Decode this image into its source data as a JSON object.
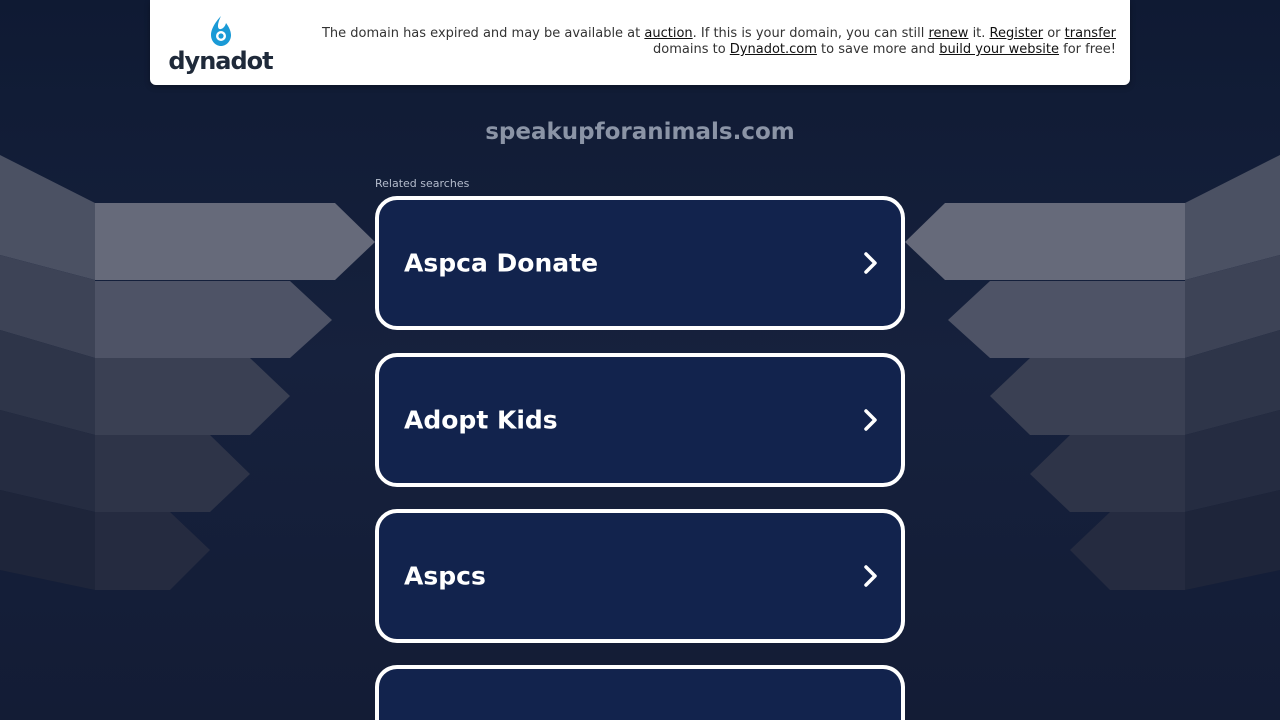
{
  "header": {
    "logo_text": "dynadot",
    "notice": {
      "line1_prefix": "The domain has expired and may be available at ",
      "auction_link": "auction",
      "line1_middle": ". If this is your domain, you can still ",
      "renew_link": "renew",
      "line1_middle2": " it. ",
      "register_link": "Register",
      "line1_or": " or ",
      "transfer_link": "transfer",
      "line2_prefix": " domains to ",
      "dynadot_link": "Dynadot.com",
      "line2_middle": " to save more and ",
      "build_link": "build your website",
      "line2_suffix": " for free!"
    }
  },
  "domain": "speakupforanimals.com",
  "related_label": "Related searches",
  "searches": [
    {
      "label": "Aspca Donate"
    },
    {
      "label": "Adopt Kids"
    },
    {
      "label": "Aspcs"
    },
    {
      "label": ""
    }
  ],
  "colors": {
    "background": "#15203b",
    "card_fill": "#12234d",
    "card_border": "#ffffff",
    "domain_text": "#8b94a6"
  }
}
